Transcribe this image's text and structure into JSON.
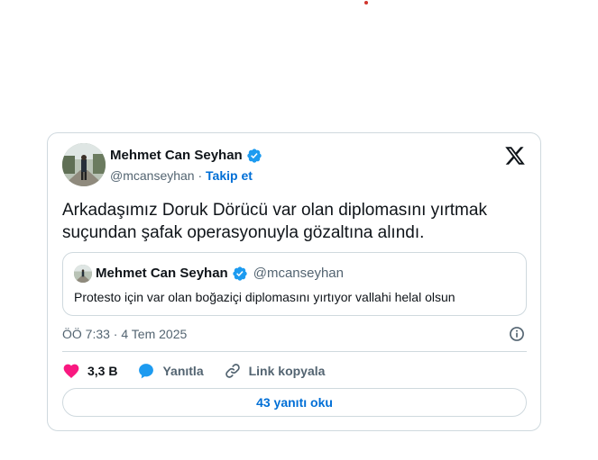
{
  "tweet": {
    "author_name": "Mehmet Can Seyhan",
    "author_handle": "@mcanseyhan",
    "separator": "·",
    "follow_label": "Takip et",
    "text_line1": "Arkadaşımız Doruk Dörücü var olan diplomasını yırtmak",
    "text_line2": "suçundan şafak operasyonuyla gözaltına alındı.",
    "timestamp": "ÖÖ 7:33 · 4 Tem 2025",
    "quote": {
      "author_name": "Mehmet Can Seyhan",
      "author_handle": "@mcanseyhan",
      "text": "Protesto için var olan boğaziçi diplomasını yırtıyor vallahi helal olsun"
    },
    "actions": {
      "likes": "3,3 B",
      "reply_label": "Yanıtla",
      "copy_link_label": "Link kopyala"
    },
    "read_replies_label": "43 yanıtı oku"
  },
  "colors": {
    "accent": "#006fd6",
    "verified": "#1d9bf0",
    "heart": "#f91880",
    "reply": "#1d9bf0",
    "border": "#cfd9de",
    "muted": "#536471"
  },
  "icons": [
    "verified-badge-icon",
    "x-logo-icon",
    "info-icon",
    "heart-icon",
    "reply-bubble-icon",
    "link-icon"
  ]
}
